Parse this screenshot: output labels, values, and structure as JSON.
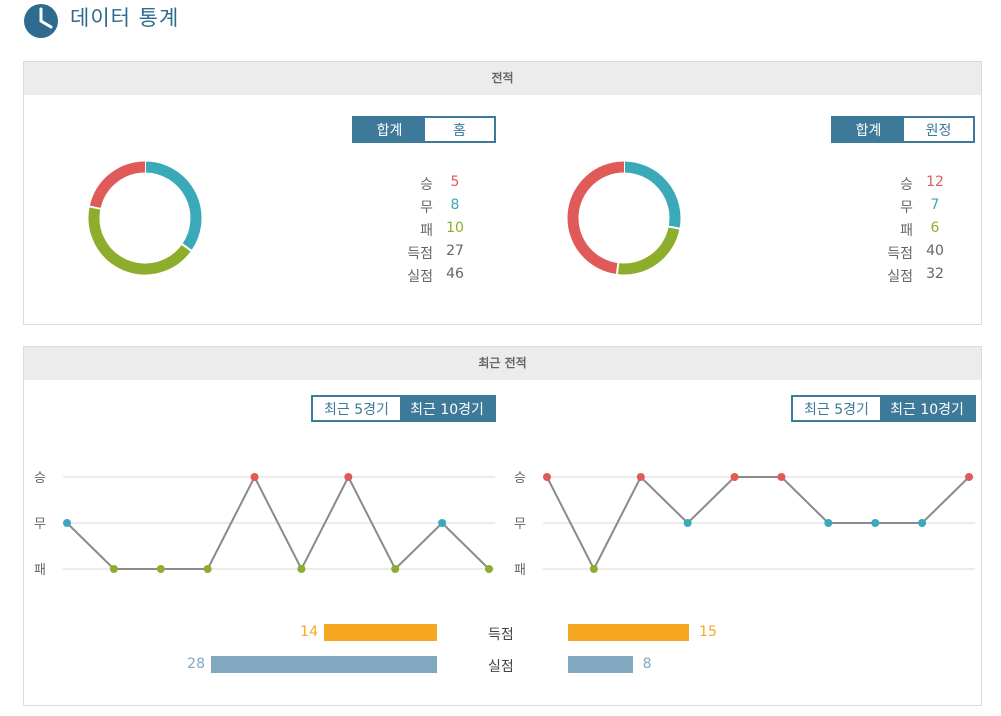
{
  "header": {
    "title": "데이터 통계",
    "icon": "pie-chart-icon"
  },
  "record_section": {
    "title": "전적",
    "left": {
      "tabs": [
        "합계",
        "홈"
      ],
      "active_tab": 0,
      "stats": [
        {
          "label": "승",
          "value": "5",
          "kind": "win"
        },
        {
          "label": "무",
          "value": "8",
          "kind": "draw"
        },
        {
          "label": "패",
          "value": "10",
          "kind": "loss"
        },
        {
          "label": "득점",
          "value": "27",
          "kind": "plain"
        },
        {
          "label": "실점",
          "value": "46",
          "kind": "plain"
        }
      ],
      "donut": [
        5,
        8,
        10
      ]
    },
    "right": {
      "tabs": [
        "합계",
        "원정"
      ],
      "active_tab": 0,
      "stats": [
        {
          "label": "승",
          "value": "12",
          "kind": "win"
        },
        {
          "label": "무",
          "value": "7",
          "kind": "draw"
        },
        {
          "label": "패",
          "value": "6",
          "kind": "loss"
        },
        {
          "label": "득점",
          "value": "40",
          "kind": "plain"
        },
        {
          "label": "실점",
          "value": "32",
          "kind": "plain"
        }
      ],
      "donut": [
        12,
        7,
        6
      ]
    }
  },
  "recent_section": {
    "title": "최근 전적",
    "tabs": [
      "최근 5경기",
      "최근 10경기"
    ],
    "active_tab": 1,
    "result_labels": [
      "승",
      "무",
      "패"
    ],
    "bar_labels": {
      "scored": "득점",
      "conceded": "실점"
    },
    "left": {
      "results": [
        "D",
        "L",
        "L",
        "L",
        "W",
        "L",
        "W",
        "L",
        "D",
        "L"
      ],
      "scored": 14,
      "conceded": 28
    },
    "right": {
      "results": [
        "W",
        "L",
        "W",
        "D",
        "W",
        "W",
        "D",
        "D",
        "D",
        "W"
      ],
      "scored": 15,
      "conceded": 8
    }
  },
  "colors": {
    "win": "#e05a5a",
    "draw": "#3aa9b8",
    "loss": "#8dad2c",
    "accent": "#3d7a99",
    "scored_bar": "#f7a823",
    "conceded_bar": "#82a8bf"
  }
}
